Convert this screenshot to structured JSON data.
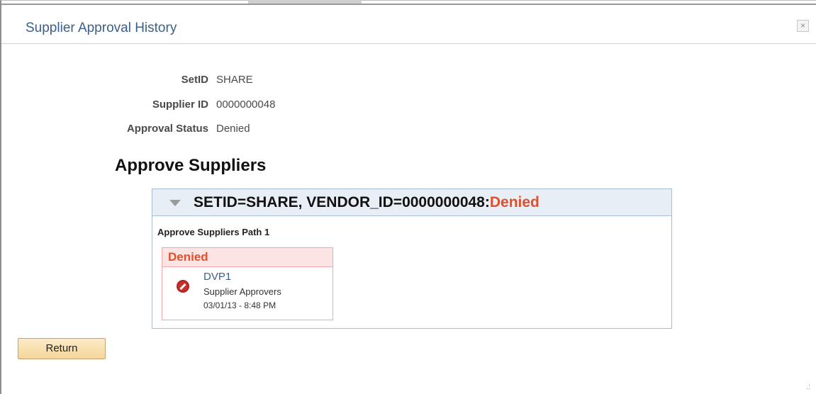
{
  "dialog": {
    "title": "Supplier Approval History",
    "close_label": "×"
  },
  "fields": [
    {
      "label": "SetID",
      "value": "SHARE"
    },
    {
      "label": "Supplier ID",
      "value": "0000000048"
    },
    {
      "label": "Approval Status",
      "value": "Denied"
    }
  ],
  "section": {
    "title": "Approve Suppliers"
  },
  "panel": {
    "heading_prefix": "SETID=SHARE, VENDOR_ID=0000000048:",
    "heading_status": "Denied",
    "path_label": "Approve Suppliers Path 1",
    "step": {
      "status": "Denied",
      "approver": "DVP1",
      "role": "Supplier Approvers",
      "timestamp": "03/01/13 - 8:48 PM"
    }
  },
  "buttons": {
    "return_label": "Return"
  },
  "icons": {
    "collapse": "triangle-down-icon",
    "status": "deny-icon",
    "close": "close-icon",
    "resize": "resize-grip-icon"
  },
  "colors": {
    "title": "#3a5f8a",
    "denied": "#e0502c",
    "panel_header": "#e8eef5",
    "step_header": "#fde4e4",
    "button": "#f5d699"
  }
}
